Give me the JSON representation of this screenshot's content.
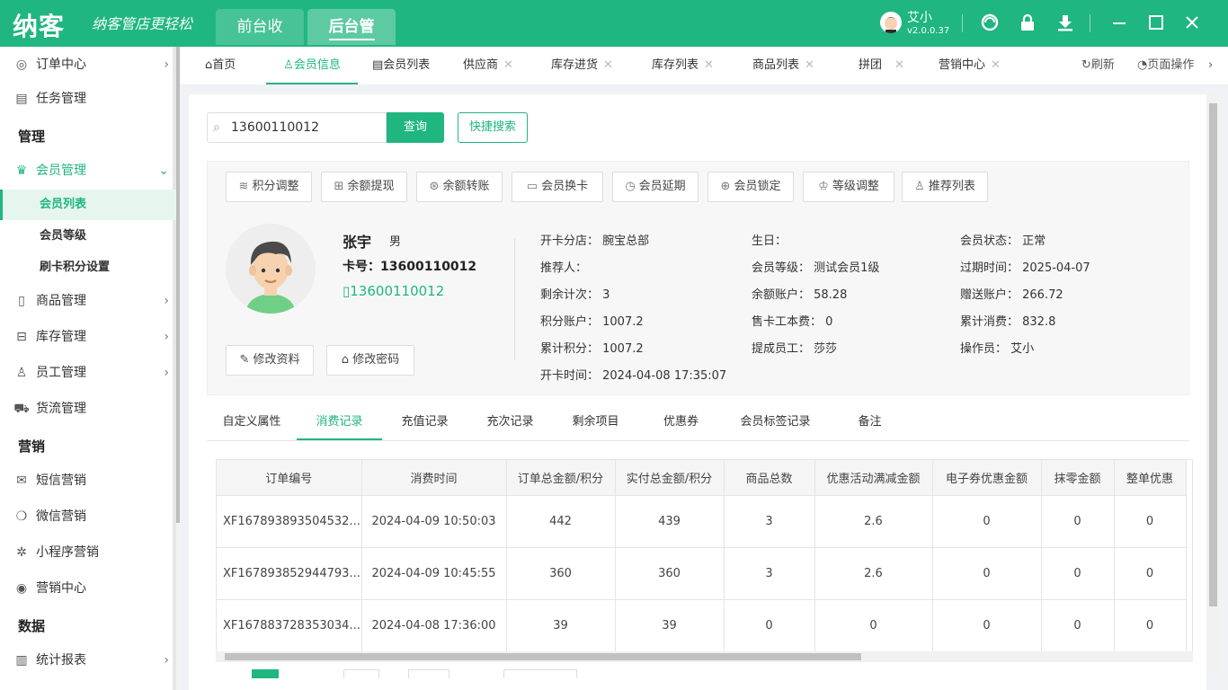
{
  "app": {
    "logo": "纳客",
    "slogan": "纳客管店更轻松",
    "top_tabs": [
      {
        "label": "前台收银"
      },
      {
        "label": "后台管理"
      }
    ],
    "user": {
      "name": "艾小",
      "version": "v2.0.0.37"
    },
    "icons": [
      "support-icon",
      "lock-icon",
      "download-icon",
      "minimize-icon",
      "maximize-icon",
      "close-icon"
    ],
    "accent_color": "#1fb67f"
  },
  "sidebar": {
    "items": [
      {
        "label": "订单中心",
        "icon": "globe-icon"
      },
      {
        "label": "任务管理",
        "icon": "task-icon"
      },
      {
        "label": "会员管理",
        "icon": "crown-icon"
      },
      {
        "label": "商品管理",
        "icon": "goods-icon"
      },
      {
        "label": "库存管理",
        "icon": "inventory-icon"
      },
      {
        "label": "员工管理",
        "icon": "user-icon"
      },
      {
        "label": "货流管理",
        "icon": "truck-icon"
      },
      {
        "label": "短信营销",
        "icon": "mail-icon"
      },
      {
        "label": "微信营销",
        "icon": "wechat-icon"
      },
      {
        "label": "小程序营销",
        "icon": "miniprogram-icon"
      },
      {
        "label": "营销中心",
        "icon": "target-icon"
      },
      {
        "label": "统计报表",
        "icon": "chart-icon"
      }
    ],
    "headings": [
      "管理",
      "营销",
      "数据"
    ],
    "member_sub": [
      {
        "label": "会员列表"
      },
      {
        "label": "会员等级"
      },
      {
        "label": "刷卡积分设置"
      }
    ]
  },
  "page_tabs": {
    "tabs": [
      {
        "label": "首页"
      },
      {
        "label": "会员信息"
      },
      {
        "label": "会员列表"
      },
      {
        "label": "供应商"
      },
      {
        "label": "库存进货"
      },
      {
        "label": "库存列表"
      },
      {
        "label": "商品列表"
      },
      {
        "label": "拼团"
      },
      {
        "label": "营销中心"
      }
    ],
    "refresh": "刷新",
    "page_ops": "页面操作"
  },
  "search": {
    "value": "13600110012",
    "button": "查询",
    "quick": "快捷搜索"
  },
  "actions": [
    {
      "label": "积分调整"
    },
    {
      "label": "余额提现"
    },
    {
      "label": "余额转账"
    },
    {
      "label": "会员换卡"
    },
    {
      "label": "会员延期"
    },
    {
      "label": "会员锁定"
    },
    {
      "label": "等级调整"
    },
    {
      "label": "推荐列表"
    }
  ],
  "member": {
    "name": "张宇",
    "gender": "男",
    "card": "卡号：13600110012",
    "phone": "13600110012",
    "edit_profile": "修改资料",
    "edit_password": "修改密码",
    "info": {
      "col1": [
        "开卡分店：  腕宝总部",
        "推荐人：",
        "剩余计次：  3",
        "积分账户：  1007.2",
        "累计积分：  1007.2",
        "开卡时间：  2024-04-08 17:35:07"
      ],
      "col2": [
        "生日：",
        "会员等级：  测试会员1级",
        "余额账户：  58.28",
        "售卡工本费：  0",
        "提成员工：  莎莎"
      ],
      "col3": [
        "会员状态：  正常",
        "过期时间：  2025-04-07",
        "赠送账户：  266.72",
        "累计消费：  832.8",
        "操作员：  艾小"
      ]
    }
  },
  "sub_tabs": [
    {
      "label": "自定义属性"
    },
    {
      "label": "消费记录"
    },
    {
      "label": "充值记录"
    },
    {
      "label": "充次记录"
    },
    {
      "label": "剩余项目"
    },
    {
      "label": "优惠券"
    },
    {
      "label": "会员标签记录"
    },
    {
      "label": "备注"
    }
  ],
  "table": {
    "headers": [
      "订单编号",
      "消费时间",
      "订单总金额/积分",
      "实付总金额/积分",
      "商品总数",
      "优惠活动满减金额",
      "电子券优惠金额",
      "抹零金额",
      "整单优惠"
    ],
    "rows": [
      [
        "XF167893893504532...",
        "2024-04-09 10:50:03",
        "442",
        "439",
        "3",
        "2.6",
        "0",
        "0",
        "0"
      ],
      [
        "XF167893852944793...",
        "2024-04-09 10:45:55",
        "360",
        "360",
        "3",
        "2.6",
        "0",
        "0",
        "0"
      ],
      [
        "XF167883728353034...",
        "2024-04-08 17:36:00",
        "39",
        "39",
        "0",
        "0",
        "0",
        "0",
        "0"
      ]
    ]
  }
}
